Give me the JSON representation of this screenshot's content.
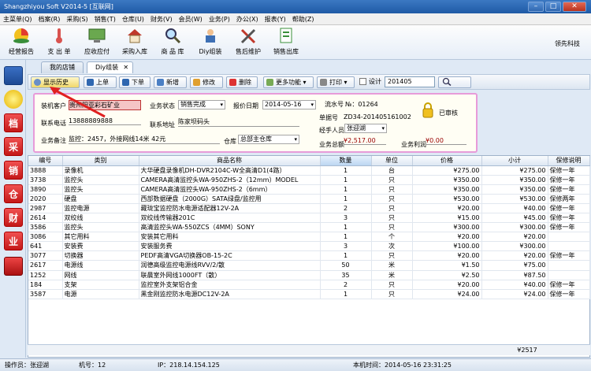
{
  "window": {
    "title": "Shangzhiyou Soft V2014-5 [互联网]"
  },
  "menu": [
    "主菜单(Q)",
    "档案(R)",
    "采购(S)",
    "销售(T)",
    "仓库(U)",
    "财务(V)",
    "会员(W)",
    "业务(P)",
    "办公(X)",
    "报表(Y)",
    "帮助(Z)"
  ],
  "toolbar": {
    "items": [
      "经营报告",
      "支 出 单",
      "应收应付",
      "采购入库",
      "商 品 库",
      "Diy组装",
      "售后维护",
      "销售出库"
    ],
    "company": "领先科技"
  },
  "tabs": {
    "store": "我的店铺",
    "diy": "Diy组装",
    "close": "✕"
  },
  "actions": {
    "history": "显示历史",
    "prev": "上单",
    "next": "下单",
    "new": "新增",
    "edit": "修改",
    "delete": "删除",
    "more": "更多功能",
    "print": "打印",
    "design": "设计",
    "search_value": "201405"
  },
  "form": {
    "customer_label": "装机客户",
    "customer_value": "贵州阳亚彩石矿业",
    "status_label": "业务状态",
    "status_value": "销售完成",
    "date_label": "报价日期",
    "date_value": "2014-05-16",
    "serial_label": "流水号",
    "serial_value": "№：01264",
    "phone_label": "联系电话",
    "phone_value": "13888889888",
    "address_label": "联系地址",
    "address_value": "陈家坝码头",
    "order_label": "单据号",
    "order_value": "ZD34-201405161002",
    "handler_label": "经手人员",
    "handler_value": "张迎湖",
    "note_label": "业务备注",
    "note_value": "监控：2457，外接网线14米 42元",
    "warehouse_label": "仓库",
    "warehouse_value": "总部主仓库",
    "total_label": "业务总额",
    "total_value": "¥2,517.00",
    "profit_label": "业务利润",
    "profit_value": "¥0.00",
    "audit": "已审核"
  },
  "table": {
    "headers": [
      "编号",
      "类别",
      "商品名称",
      "数量",
      "单位",
      "价格",
      "小计",
      "保修说明"
    ],
    "rows": [
      [
        "3888",
        "录像机",
        "大华硬盘录像机DH-DVR2104C-W全高清D1(4路）",
        "1",
        "台",
        "¥275.00",
        "¥275.00",
        "保修一年"
      ],
      [
        "3738",
        "监控头",
        "CAMERA高清监控头WA-950ZHS-2（12mm）MODEL",
        "1",
        "只",
        "¥350.00",
        "¥350.00",
        "保修一年"
      ],
      [
        "3890",
        "监控头",
        "CAMERA高清监控头WA-950ZHS-2（6mm）",
        "1",
        "只",
        "¥350.00",
        "¥350.00",
        "保修一年"
      ],
      [
        "2020",
        "硬盘",
        "西部数据硬盘（2000G）SATA绿盘/监控用",
        "1",
        "只",
        "¥530.00",
        "¥530.00",
        "保修两年"
      ],
      [
        "2987",
        "监控电源",
        "藏珑宝监控防水电源适配器12V-2A",
        "2",
        "只",
        "¥20.00",
        "¥40.00",
        "保修一年"
      ],
      [
        "2614",
        "双绞线",
        "双绞线传输器201C",
        "3",
        "只",
        "¥15.00",
        "¥45.00",
        "保修一年"
      ],
      [
        "3586",
        "监控头",
        "高清监控头WA-550ZCS（4MM）SONY",
        "1",
        "只",
        "¥300.00",
        "¥300.00",
        "保修一年"
      ],
      [
        "3086",
        "其它用料",
        "安装其它用料",
        "1",
        "个",
        "¥20.00",
        "¥20.00",
        ""
      ],
      [
        "641",
        "安装费",
        "安装服务费",
        "3",
        "次",
        "¥100.00",
        "¥300.00",
        ""
      ],
      [
        "3077",
        "切换器",
        "PEDF高清VGA切换器OB-15-2C",
        "1",
        "只",
        "¥20.00",
        "¥20.00",
        "保修一年"
      ],
      [
        "2617",
        "电源线",
        "润德高级监控电源线RVV/2/散",
        "50",
        "米",
        "¥1.50",
        "¥75.00",
        ""
      ],
      [
        "1252",
        "网线",
        "联晨室外网线1000FT（散）",
        "35",
        "米",
        "¥2.50",
        "¥87.50",
        ""
      ],
      [
        "184",
        "支架",
        "监控室外支架铝合金",
        "2",
        "只",
        "¥20.00",
        "¥40.00",
        "保修一年"
      ],
      [
        "3587",
        "电源",
        "黑金刚监控防水电源DC12V-2A",
        "1",
        "只",
        "¥24.00",
        "¥24.00",
        "保修一年"
      ]
    ],
    "grand_total": "¥2517"
  },
  "status": {
    "operator": "操作员：张迎湖",
    "machine": "机号：12",
    "ip": "IP：218.14.154.125",
    "time": "本机时间：2014-05-16 23:31:25"
  }
}
